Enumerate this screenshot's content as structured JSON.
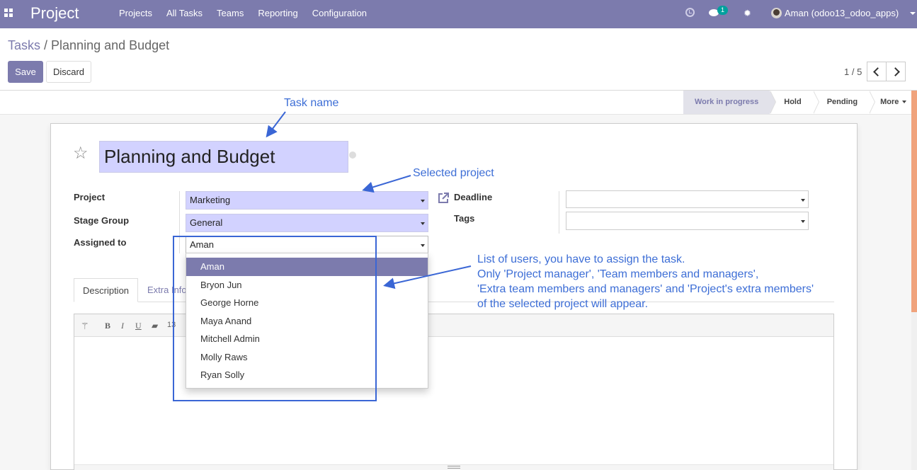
{
  "navbar": {
    "brand": "Project",
    "menu": [
      "Projects",
      "All Tasks",
      "Teams",
      "Reporting",
      "Configuration"
    ],
    "messages_count": "1",
    "user": "Aman (odoo13_odoo_apps)"
  },
  "breadcrumb": {
    "parent": "Tasks",
    "separator": " / ",
    "current": "Planning and Budget"
  },
  "buttons": {
    "save": "Save",
    "discard": "Discard"
  },
  "pager": {
    "value": "1 / 5"
  },
  "stages": [
    "Work in progress",
    "Hold",
    "Pending"
  ],
  "stage_more": "More",
  "form": {
    "task_name": "Planning and Budget",
    "labels": {
      "project": "Project",
      "stage_group": "Stage Group",
      "assigned_to": "Assigned to",
      "deadline": "Deadline",
      "tags": "Tags"
    },
    "values": {
      "project": "Marketing",
      "stage_group": "General",
      "assigned_to": "Aman",
      "deadline": "",
      "tags": ""
    }
  },
  "tabs": [
    "Description",
    "Extra Info"
  ],
  "editor_toolbar": {
    "font_size": "13"
  },
  "dropdown": {
    "items": [
      "Aman",
      "Bryon Jun",
      "George Horne",
      "Maya Anand",
      "Mitchell Admin",
      "Molly Raws",
      "Ryan Solly"
    ],
    "selected": "Aman"
  },
  "annotations": {
    "task_name": "Task name",
    "selected_project": "Selected project",
    "users_list": [
      "List of users, you have to assign the task.",
      "Only 'Project manager', 'Team members and managers',",
      "'Extra team members and managers' and 'Project's extra members'",
      "of the selected project will appear."
    ]
  },
  "colors": {
    "brand": "#7c7bad",
    "required_field": "#d2d2ff",
    "annotation": "#3d6ed6",
    "badge": "#00a09d"
  }
}
